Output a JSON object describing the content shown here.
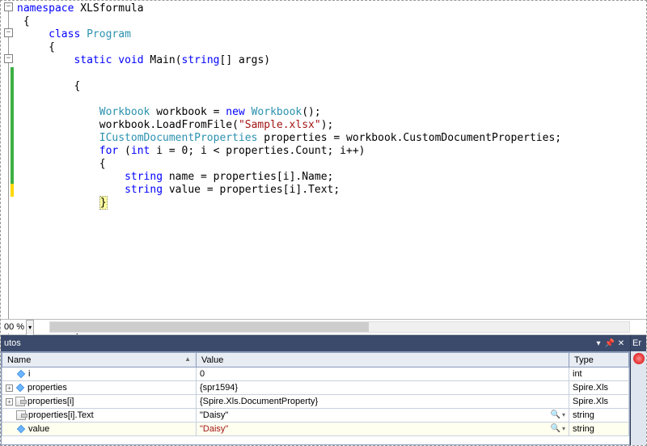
{
  "code": {
    "ns_kw": "namespace",
    "ns": " XLSformula",
    "ob1": "{",
    "class_kw": "class",
    "class": " Program",
    "ob2": "{",
    "static": "static",
    "void": "void",
    "main": " Main(",
    "string": "string",
    "main_args": "[] args)",
    "ob3": "{",
    "wb_type": "Workbook",
    "wb_decl": " workbook = ",
    "new": "new",
    "wb_ctor": "Workbook",
    "wb_end": "();",
    "load": "workbook.LoadFromFile(",
    "load_str": "\"Sample.xlsx\"",
    "load_end": ");",
    "icp": "ICustomDocumentProperties",
    "icp_decl": " properties = workbook.CustomDocumentProperties;",
    "for": "for",
    "for_open": " (",
    "int": "int",
    "for_body": " i = 0; i < properties.Count; i++)",
    "ob4": "{",
    "string2": "string",
    "name_line": " name = properties[i].Name;",
    "string3": "string",
    "value_line": " value = properties[i].Text;",
    "cb4": "}",
    "cb3": "}"
  },
  "zoom": {
    "label": "00 %"
  },
  "panel": {
    "title": "utos",
    "err_title": "Er",
    "cols": {
      "name": "Name",
      "value": "Value",
      "type": "Type"
    },
    "rows": [
      {
        "icon": "blue",
        "name": "i",
        "value": "0",
        "type": "int",
        "expand": ""
      },
      {
        "icon": "blue",
        "name": "properties",
        "value": "{spr1594}",
        "type": "Spire.Xls",
        "expand": "+"
      },
      {
        "icon": "prop",
        "name": "properties[i]",
        "value": "{Spire.Xls.DocumentProperty}",
        "type": "Spire.Xls",
        "expand": "+"
      },
      {
        "icon": "prop",
        "name": "properties[i].Text",
        "value": "\"Daisy\"",
        "type": "string",
        "mag": true
      },
      {
        "icon": "blue",
        "name": "value",
        "value": "\"Daisy\"",
        "type": "string",
        "red": true,
        "mag": true
      }
    ]
  }
}
